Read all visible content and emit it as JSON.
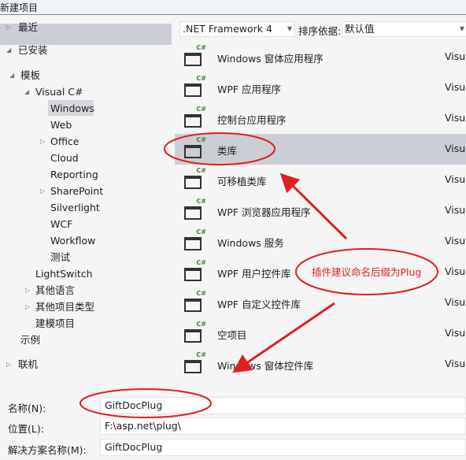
{
  "title": "新建项目",
  "sidebar": {
    "recent": "最近",
    "installed": "已安装",
    "templates": "模板",
    "visual_csharp": "Visual C#",
    "children": [
      "Windows",
      "Web",
      "Office",
      "Cloud",
      "Reporting",
      "SharePoint",
      "Silverlight",
      "WCF",
      "Workflow",
      "测试"
    ],
    "lightswitch": "LightSwitch",
    "other_languages": "其他语言",
    "other_project_types": "其他项目类型",
    "modeling": "建模项目",
    "samples": "示例",
    "online": "联机"
  },
  "toolbar": {
    "framework": ".NET Framework 4",
    "sort_label": "排序依据:",
    "sort_value": "默认值"
  },
  "templates": [
    {
      "name": "Windows 窗体应用程序",
      "lang": "Visua"
    },
    {
      "name": "WPF 应用程序",
      "lang": "Visua"
    },
    {
      "name": "控制台应用程序",
      "lang": "Visua"
    },
    {
      "name": "类库",
      "lang": "Visua",
      "selected": true
    },
    {
      "name": "可移植类库",
      "lang": "Visua"
    },
    {
      "name": "WPF 浏览器应用程序",
      "lang": "Visua"
    },
    {
      "name": "Windows 服务",
      "lang": "Visua"
    },
    {
      "name": "WPF 用户控件库",
      "lang": "Visua"
    },
    {
      "name": "WPF 自定义控件库",
      "lang": "Visua"
    },
    {
      "name": "空项目",
      "lang": "Visua"
    },
    {
      "name": "Windows 窗体控件库",
      "lang": "Visua"
    }
  ],
  "form": {
    "name_label": "名称(N):",
    "name_value": "GiftDocPlug",
    "location_label": "位置(L):",
    "location_value": "F:\\asp.net\\plug\\",
    "solution_label": "解决方案名称(M):",
    "solution_value": "GiftDocPlug"
  },
  "annotation": {
    "note": "插件建议命名后缀为Plug",
    "color": "#e02020"
  }
}
